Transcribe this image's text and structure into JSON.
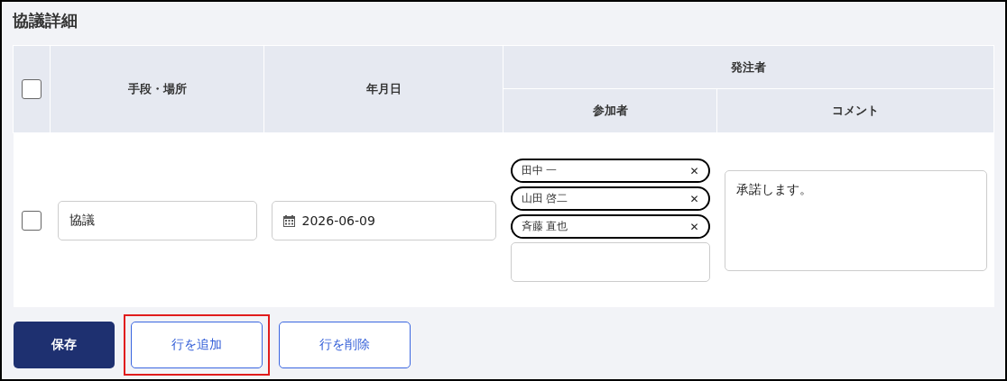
{
  "title": "協議詳細",
  "table": {
    "header_checkbox": {
      "checked": false
    },
    "columns": [
      "手段・場所",
      "年月日"
    ],
    "group": {
      "label": "発注者",
      "columns": [
        "参加者",
        "コメント"
      ]
    },
    "rows": [
      {
        "checked": false,
        "method": "協議",
        "date": "2026-06-09",
        "participants": [
          {
            "name": "田中 一",
            "remove": "✕"
          },
          {
            "name": "山田 啓二",
            "remove": "✕"
          },
          {
            "name": "斉藤 直也",
            "remove": "✕"
          }
        ],
        "comment": "承諾します。"
      }
    ]
  },
  "buttons": [
    {
      "label": "保存",
      "kind": "primary",
      "highlighted": false
    },
    {
      "label": "行を追加",
      "kind": "secondary",
      "highlighted": true
    },
    {
      "label": "行を削除",
      "kind": "secondary",
      "highlighted": false
    }
  ]
}
